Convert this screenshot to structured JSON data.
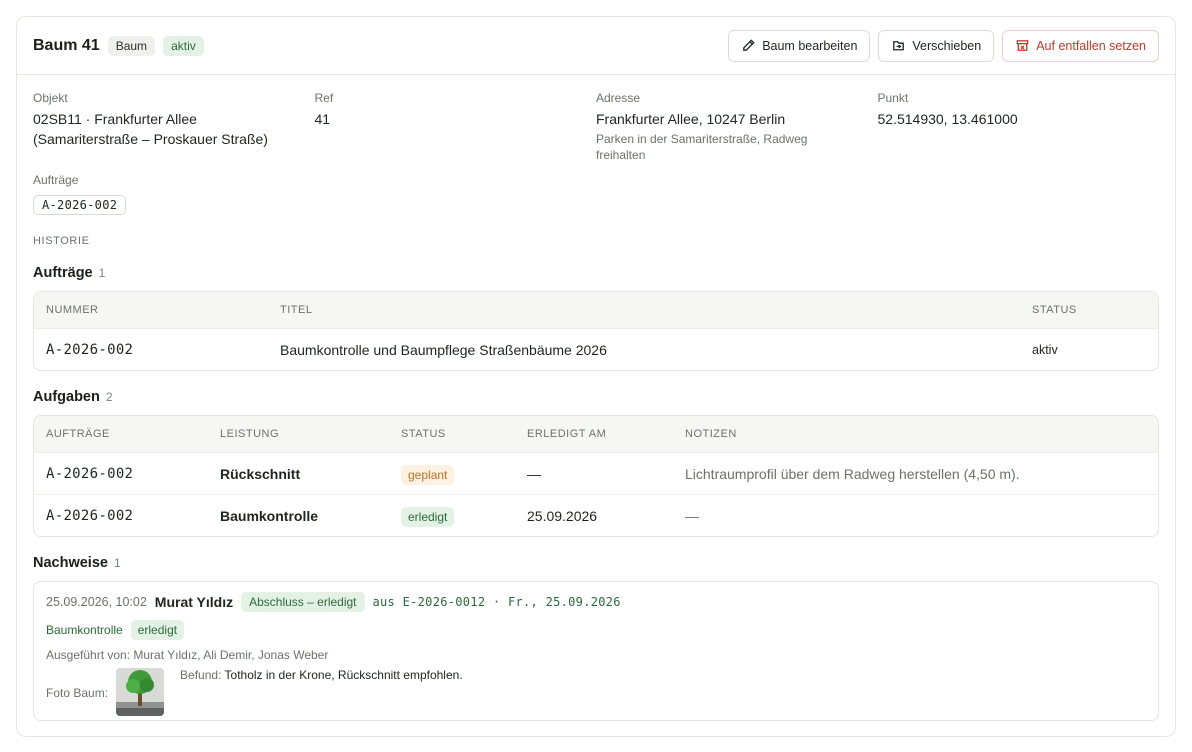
{
  "header": {
    "title": "Baum 41",
    "type_chip": "Baum",
    "status_chip": "aktiv",
    "buttons": {
      "edit": "Baum bearbeiten",
      "move": "Verschieben",
      "drop": "Auf entfallen setzen"
    }
  },
  "facts": {
    "objekt": {
      "label": "Objekt",
      "line1": "02SB11 · Frankfurter Allee",
      "line2": "(Samariterstraße – Proskauer Straße)"
    },
    "ref": {
      "label": "Ref",
      "value": "41"
    },
    "adresse": {
      "label": "Adresse",
      "value": "Frankfurter Allee, 10247 Berlin",
      "note": "Parken in der Samariterstraße, Radweg freihalten"
    },
    "punkt": {
      "label": "Punkt",
      "value": "52.514930, 13.461000"
    },
    "auftraege": {
      "label": "Aufträge",
      "tag": "A-2026-002"
    }
  },
  "history_label": "HISTORIE",
  "orders": {
    "title": "Aufträge",
    "count": "1",
    "columns": [
      "NUMMER",
      "TITEL",
      "STATUS"
    ],
    "rows": [
      {
        "nummer": "A-2026-002",
        "titel": "Baumkontrolle und Baumpflege Straßenbäume 2026",
        "status": "aktiv"
      }
    ]
  },
  "tasks": {
    "title": "Aufgaben",
    "count": "2",
    "columns": [
      "AUFTRÄGE",
      "LEISTUNG",
      "STATUS",
      "ERLEDIGT AM",
      "NOTIZEN"
    ],
    "rows": [
      {
        "auftrag": "A-2026-002",
        "leistung": "Rückschnitt",
        "status": "geplant",
        "erledigt": "—",
        "notiz": "Lichtraumprofil über dem Radweg herstellen (4,50 m)."
      },
      {
        "auftrag": "A-2026-002",
        "leistung": "Baumkontrolle",
        "status": "erledigt",
        "erledigt": "25.09.2026",
        "notiz": "—"
      }
    ]
  },
  "proofs": {
    "title": "Nachweise",
    "count": "1",
    "item": {
      "timestamp": "25.09.2026, 10:02",
      "person": "Murat Yıldız",
      "badge": "Abschluss – erledigt",
      "source": "aus E-2026-0012 · Fr., 25.09.2026",
      "service": "Baumkontrolle",
      "service_status": "erledigt",
      "executed_by": "Ausgeführt von: Murat Yıldız, Ali Demir, Jonas Weber",
      "photo_label": "Foto Baum:",
      "finding_label": "Befund:",
      "finding_text": "Totholz in der Krone, Rückschnitt empfohlen."
    }
  },
  "colors": {
    "accent_green": "#2b6a3a",
    "danger": "#c0392b",
    "planned": "#b9731f"
  }
}
